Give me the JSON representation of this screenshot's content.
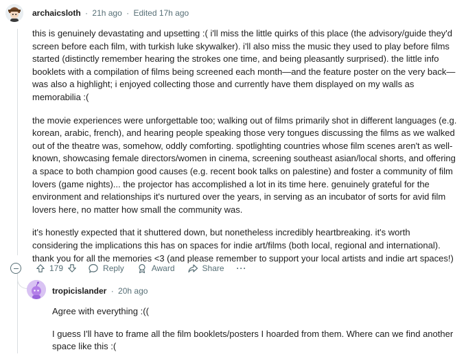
{
  "comment": {
    "author": "archaicsloth",
    "time": "21h ago",
    "edited": "Edited 17h ago",
    "paragraphs": [
      "this is genuinely devastating and upsetting :( i'll miss the little quirks of this place (the advisory/guide they'd screen before each film, with turkish luke skywalker). i'll also miss the music they used to play before films started (distinctly remember hearing the strokes one time, and being pleasantly surprised). the little info booklets with a compilation of films being screened each month—and the feature poster on the very back—was also a highlight; i enjoyed collecting those and currently have them displayed on my walls as memorabilia :(",
      "the movie experiences were unforgettable too; walking out of films primarily shot in different languages (e.g. korean, arabic, french), and hearing people speaking those very tongues discussing the films as we walked out of the theatre was, somehow, oddly comforting. spotlighting countries whose film scenes aren't as well-known, showcasing female directors/women in cinema, screening southeast asian/local shorts, and offering a space to both champion good causes (e.g. recent book talks on palestine) and foster a community of film lovers (game nights)... the projector has accomplished a lot in its time here. genuinely grateful for the environment and relationships it's nurtured over the years, in serving as an incubator of sorts for avid film lovers here, no matter how small the community was.",
      "it's honestly expected that it shuttered down, but nonetheless incredibly heartbreaking. it's worth considering the implications this has on spaces for indie art/films (both local, regional and international). thank you for all the memories <3 (and please remember to support your local artists and indie art spaces!)"
    ],
    "votes": "179",
    "actions": {
      "reply": "Reply",
      "award": "Award",
      "share": "Share",
      "more": "···"
    }
  },
  "reply": {
    "author": "tropicislander",
    "time": "20h ago",
    "paragraphs": [
      "Agree with everything :((",
      "I guess I'll have to frame all the film booklets/posters I hoarded from them. Where can we find another space like this :("
    ]
  },
  "colors": {
    "meta": "#576f76",
    "thread": "#d9dde0",
    "reply_avatar": "#d9c3f3"
  }
}
